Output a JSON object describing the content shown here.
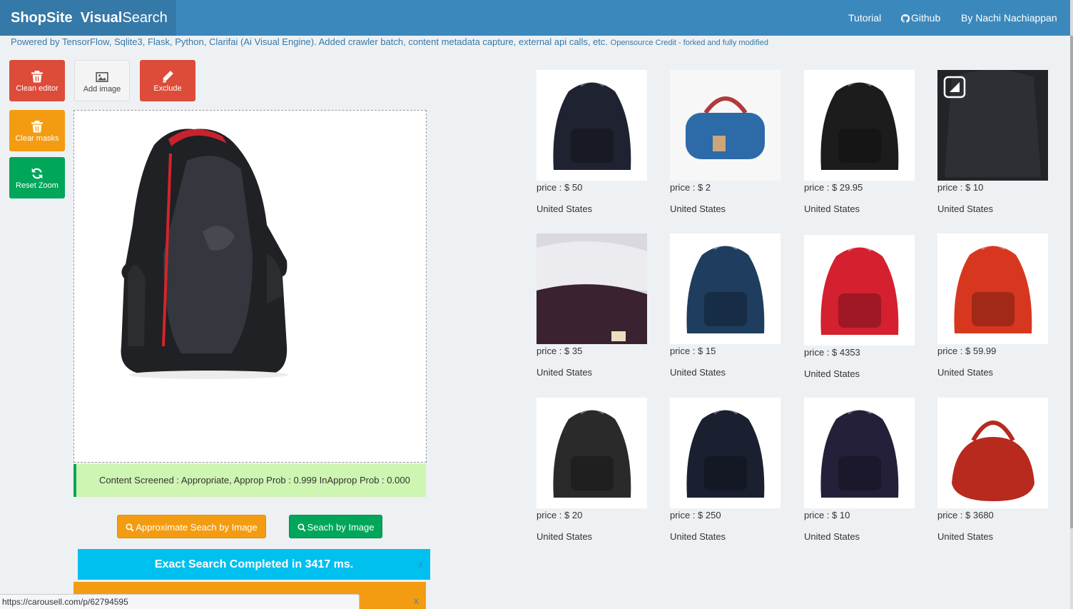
{
  "header": {
    "brand_part1": "ShopSite",
    "brand_part2": "Visual",
    "brand_part3": "Search",
    "nav": [
      {
        "label": "Tutorial"
      },
      {
        "label": "Github",
        "icon": "github-icon"
      },
      {
        "label": "By Nachi Nachiappan"
      }
    ]
  },
  "subtitle": {
    "text": "Powered by TensorFlow, Sqlite3, Flask, Python, Clarifai (Ai Visual Engine). Added crawler batch, content metadata capture, external api calls, etc.",
    "credit": "Opensource Credit - forked and fully modified"
  },
  "toolbar": {
    "clean_editor": "Clean editor",
    "add_image": "Add image",
    "exclude": "Exclude",
    "clear_masks": "Clear masks",
    "reset_zoom": "Reset Zoom"
  },
  "screening": {
    "text": "Content Screened : Appropriate, Approp Prob : 0.999 InApprop Prob : 0.000"
  },
  "search": {
    "approx_label": "Approximate Seach by Image",
    "exact_label": "Seach by Image"
  },
  "alerts": {
    "completed": "Exact Search Completed in 3417 ms.",
    "close": "x"
  },
  "status_url": "https://carousell.com/p/62794595",
  "results": [
    {
      "price": "price : $ 50",
      "country": "United States",
      "color": "#1f2230",
      "kind": "backpack"
    },
    {
      "price": "price : $ 2",
      "country": "United States",
      "color": "#2d6aa8",
      "kind": "duffel"
    },
    {
      "price": "price : $ 29.95",
      "country": "United States",
      "color": "#1c1c1c",
      "kind": "backpack"
    },
    {
      "price": "price : $ 10",
      "country": "United States",
      "color": "#222428",
      "kind": "closeup"
    },
    {
      "price": "price : $ 35",
      "country": "United States",
      "color": "#3a2230",
      "kind": "drawstring"
    },
    {
      "price": "price : $ 15",
      "country": "United States",
      "color": "#1f3d5e",
      "kind": "backpack"
    },
    {
      "price": "price : $ 4353",
      "country": "United States",
      "color": "#d4202f",
      "kind": "backpack"
    },
    {
      "price": "price : $ 59.99",
      "country": "United States",
      "color": "#d8371f",
      "kind": "backpack"
    },
    {
      "price": "price : $ 20",
      "country": "United States",
      "color": "#2a2a2a",
      "kind": "backpack"
    },
    {
      "price": "price : $ 250",
      "country": "United States",
      "color": "#1a2030",
      "kind": "backpack"
    },
    {
      "price": "price : $ 10",
      "country": "United States",
      "color": "#24203a",
      "kind": "backpack"
    },
    {
      "price": "price : $ 3680",
      "country": "United States",
      "color": "#b8291e",
      "kind": "handbag"
    }
  ]
}
